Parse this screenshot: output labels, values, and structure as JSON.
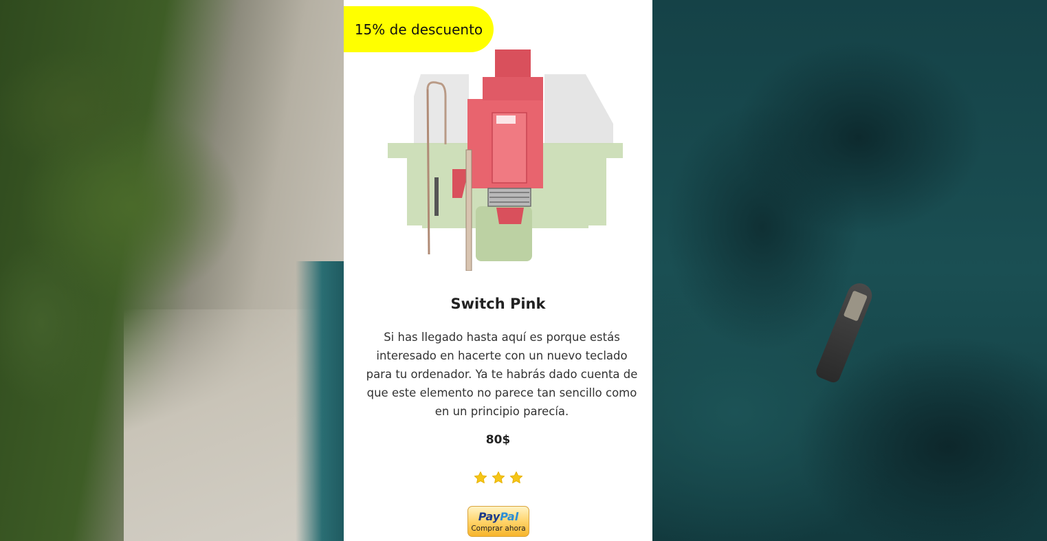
{
  "card": {
    "discount": "15% de descuento",
    "title": "Switch Pink",
    "description": "Si has llegado hasta aquí es porque estás interesado en hacerte con un nuevo teclado para tu ordenador. Ya te habrás dado cuenta de que este elemento no parece tan sencillo como en un principio parecía.",
    "price": "80$",
    "rating": 3,
    "rating_max": 3,
    "paypal": {
      "brand_pay": "Pay",
      "brand_pal": "Pal",
      "label": "Comprar ahora"
    }
  },
  "colors": {
    "badge": "#ffff00",
    "star": "#f5c518",
    "stem": "#e85f6a",
    "housing": "#c9dbb3"
  },
  "icons": {
    "star": "star-icon",
    "product": "keyboard-switch-image",
    "paypal": "paypal-logo"
  }
}
